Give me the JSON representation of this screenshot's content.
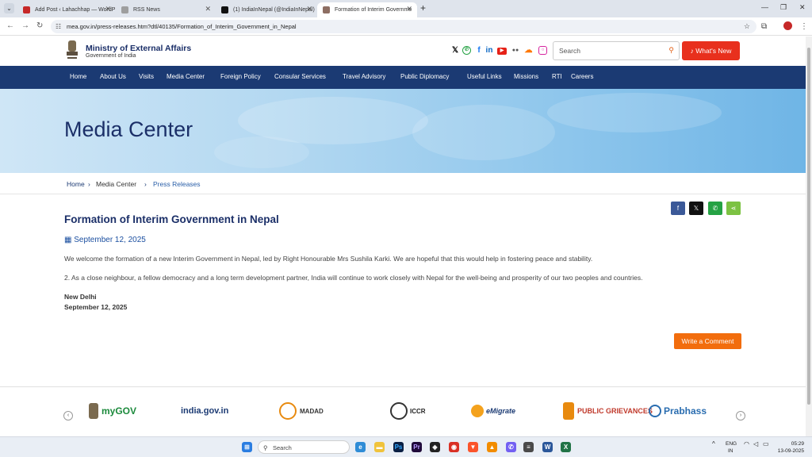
{
  "browser": {
    "tabs": [
      {
        "title": "Add Post ‹ Lahachhap — WordP",
        "color": "#c62828"
      },
      {
        "title": "RSS News",
        "color": "#9e9e9e"
      },
      {
        "title": "(1) IndiaInNepal (@IndiaInNepal)",
        "color": "#111111"
      },
      {
        "title": "Formation of Interim Governme",
        "color": "#8d6e63"
      }
    ],
    "url": "mea.gov.in/press-releases.htm?dtl/40135/Formation_of_Interim_Government_in_Nepal"
  },
  "header": {
    "ministry": "Ministry of External Affairs",
    "government": "Government of India",
    "search_placeholder": "Search",
    "whats_new": "What's New",
    "social_icons": [
      "x-icon",
      "whatsapp-icon",
      "facebook-icon",
      "linkedin-icon",
      "youtube-icon",
      "flickr-icon",
      "soundcloud-icon",
      "instagram-icon"
    ]
  },
  "nav": [
    "Home",
    "About Us",
    "Visits",
    "Media Center",
    "Foreign Policy",
    "Consular Services",
    "Travel Advisory",
    "Public Diplomacy",
    "Useful Links",
    "Missions",
    "RTI",
    "Careers"
  ],
  "banner": {
    "title": "Media Center"
  },
  "breadcrumb": {
    "home": "Home",
    "media": "Media Center",
    "current": "Press Releases"
  },
  "article": {
    "title": "Formation of Interim Government in Nepal",
    "date": "September 12, 2025",
    "para1": "We welcome the formation of a new Interim Government in Nepal, led by Right Honourable Mrs Sushila Karki. We are hopeful that this would help in fostering peace and stability.",
    "para2": "2. As a close neighbour, a fellow democracy and a long term development partner, India will continue to work closely with Nepal for the well-being and prosperity of our two peoples and countries.",
    "place": "New Delhi",
    "sig_date": "September 12, 2025",
    "comment_button": "Write a Comment"
  },
  "footer_logos": [
    "myGOV",
    "india.gov.in",
    "MADAD",
    "ICCR",
    "eMigrate",
    "PUBLIC GRIEVANCES",
    "Prabhass"
  ],
  "taskbar": {
    "search": "Search",
    "lang1": "ENG",
    "lang2": "IN",
    "time": "05:29",
    "date": "13-09-2025"
  },
  "colors": {
    "navy": "#1b3a73",
    "accent_orange": "#f26d0d",
    "whats_new_red": "#e8301d"
  }
}
